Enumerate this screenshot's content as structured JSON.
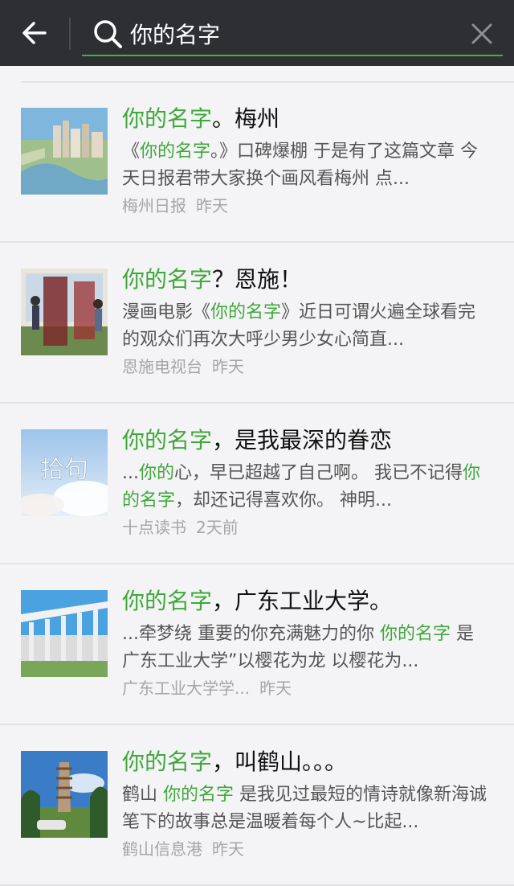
{
  "search": {
    "query": "你的名字"
  },
  "colors": {
    "highlight": "#3fa83a",
    "topbar": "#2e2f33",
    "underline": "#3fb43a"
  },
  "results": [
    {
      "title_hl": "你的名字",
      "title_rest": "。梅州",
      "desc": [
        {
          "t": "《",
          "h": false
        },
        {
          "t": "你的名字",
          "h": true
        },
        {
          "t": "。》口碑爆棚 于是有了这篇文章 今天日报君带大家换个画风看梅州 点...",
          "h": false
        }
      ],
      "source": "梅州日报",
      "time": "昨天",
      "thumb": "city-river-photo"
    },
    {
      "title_hl": "你的名字",
      "title_rest": "？恩施！",
      "desc": [
        {
          "t": "漫画电影《",
          "h": false
        },
        {
          "t": "你的名字",
          "h": true
        },
        {
          "t": "》近日可谓火遍全球看完的观众们再次大呼少男少女心简直...",
          "h": false
        }
      ],
      "source": "恩施电视台",
      "time": "昨天",
      "thumb": "anime-poster"
    },
    {
      "title_hl": "你的名字",
      "title_rest": "，是我最深的眷恋",
      "desc": [
        {
          "t": "...",
          "h": false
        },
        {
          "t": "你的",
          "h": true
        },
        {
          "t": "心，早已超越了自己啊。 我已不记得",
          "h": false
        },
        {
          "t": "你的名字",
          "h": true
        },
        {
          "t": "，却还记得喜欢你。 神明...",
          "h": false
        }
      ],
      "source": "十点读书",
      "time": "2天前",
      "thumb": "sky-calligraphy",
      "thumb_text": "拾句"
    },
    {
      "title_hl": "你的名字",
      "title_rest": "，广东工业大学。",
      "desc": [
        {
          "t": "...牵梦绕 重要的你充满魅力的你 ",
          "h": false
        },
        {
          "t": "你的名字",
          "h": true
        },
        {
          "t": " 是 广东工业大学”以樱花为龙 以樱花为...",
          "h": false
        }
      ],
      "source": "广东工业大学学...",
      "time": "昨天",
      "thumb": "campus-building"
    },
    {
      "title_hl": "你的名字",
      "title_rest": "，叫鹤山。。。",
      "desc": [
        {
          "t": "鹤山 ",
          "h": false
        },
        {
          "t": "你的名字",
          "h": true
        },
        {
          "t": " 是我见过最短的情诗就像新海诚笔下的故事总是温暖着每个人~比起...",
          "h": false
        }
      ],
      "source": "鹤山信息港",
      "time": "昨天",
      "thumb": "pagoda-landscape"
    }
  ]
}
